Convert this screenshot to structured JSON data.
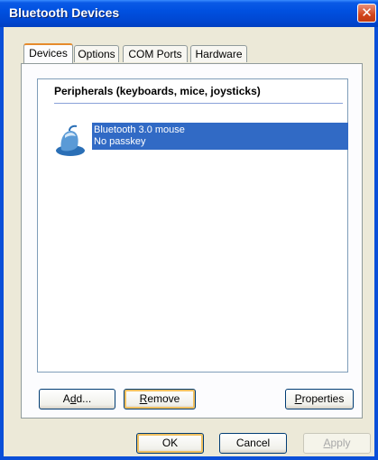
{
  "window": {
    "title": "Bluetooth Devices",
    "close_label": "✕"
  },
  "tabs": [
    {
      "label": "Devices",
      "active": true
    },
    {
      "label": "Options",
      "active": false
    },
    {
      "label": "COM Ports",
      "active": false
    },
    {
      "label": "Hardware",
      "active": false
    }
  ],
  "devices": {
    "group_header": "Peripherals (keyboards, mice, joysticks)",
    "items": [
      {
        "name": "Bluetooth 3.0 mouse",
        "status": "No passkey",
        "icon": "mouse-icon",
        "selected": true
      }
    ]
  },
  "panel_buttons": {
    "add": {
      "pre": "A",
      "accel": "d",
      "post": "d..."
    },
    "remove": {
      "pre": "",
      "accel": "R",
      "post": "emove"
    },
    "properties": {
      "pre": "",
      "accel": "P",
      "post": "roperties"
    }
  },
  "dialog_buttons": {
    "ok": "OK",
    "cancel": "Cancel",
    "apply": {
      "pre": "",
      "accel": "A",
      "post": "pply"
    }
  },
  "colors": {
    "titlebar": "#0050e0",
    "selection": "#316ac5",
    "tab_highlight": "#e68b2c",
    "dialog_bg": "#ece9d8"
  }
}
